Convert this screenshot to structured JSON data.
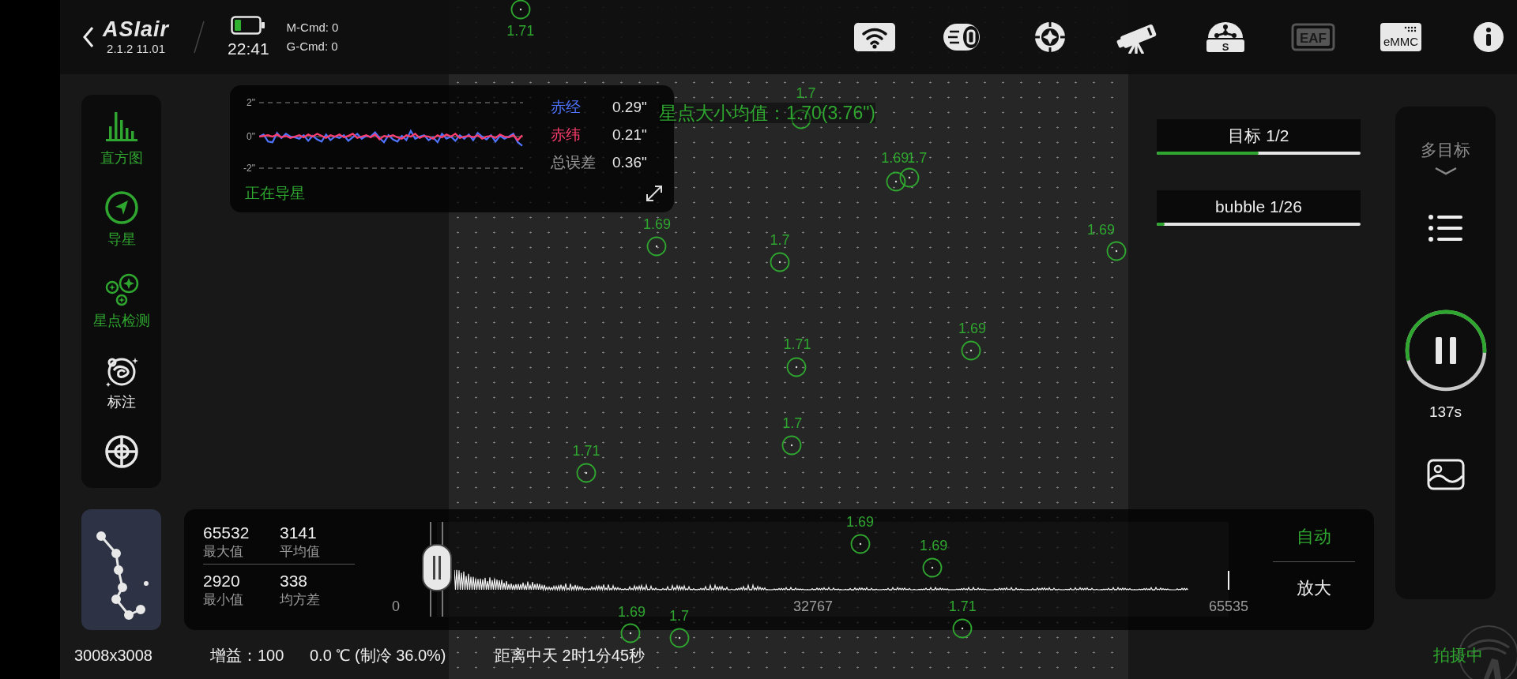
{
  "top_bar": {
    "logo": "ASIair",
    "version": "2.1.2 11.01",
    "time": "22:41",
    "m_cmd": "M-Cmd: 0",
    "g_cmd": "G-Cmd: 0",
    "icons": [
      {
        "kind": "wifi",
        "disabled": false
      },
      {
        "kind": "focuser",
        "disabled": false
      },
      {
        "kind": "guide",
        "disabled": false
      },
      {
        "kind": "telescope",
        "disabled": false
      },
      {
        "kind": "dome",
        "text": "S",
        "disabled": false
      },
      {
        "kind": "eaf",
        "text": "EAF",
        "disabled": true
      },
      {
        "kind": "emmc",
        "text": "eMMC",
        "disabled": false
      },
      {
        "kind": "info",
        "disabled": false
      }
    ]
  },
  "sidebar": {
    "items": [
      {
        "kind": "histogram",
        "label": "直方图",
        "on": true
      },
      {
        "kind": "guide",
        "label": "导星",
        "on": true
      },
      {
        "kind": "stars",
        "label": "星点检测",
        "on": true
      },
      {
        "kind": "annotate",
        "label": "标注",
        "on": false
      },
      {
        "kind": "crosshair",
        "on": false
      }
    ]
  },
  "guide_panel": {
    "yticks": [
      "2\"",
      "0\"",
      "-2\""
    ],
    "stats": [
      {
        "label": "赤经",
        "value": "0.29\"",
        "color": "#4f74ff"
      },
      {
        "label": "赤纬",
        "value": "0.21\"",
        "color": "#ff3d6e"
      },
      {
        "label": "总误差",
        "value": "0.36\"",
        "color": "#9a9a9a"
      }
    ],
    "status": "正在导星"
  },
  "star_size_average": "星点大小均值：1.70(3.76\")",
  "star_markers": [
    {
      "label": "1.71"
    },
    {
      "label": "1.7"
    },
    {
      "label": "1.69"
    },
    {
      "label": "1.7"
    },
    {
      "label": "1.69"
    },
    {
      "label": "1.7"
    },
    {
      "label": "1.69"
    },
    {
      "label": "1.69"
    },
    {
      "label": "1.71"
    },
    {
      "label": "1.7"
    },
    {
      "label": "1.71"
    },
    {
      "label": "1.69"
    },
    {
      "label": "1.69"
    },
    {
      "label": "1.71"
    },
    {
      "label": "1.7"
    },
    {
      "label": "1.69"
    }
  ],
  "sequence": [
    {
      "label": "目标 1/2",
      "level": 0.5
    },
    {
      "label": "bubble 1/26",
      "level": 0.04
    }
  ],
  "right_panel": {
    "mode": "多目标",
    "exposure": {
      "level": 0.55,
      "remaining": "137s"
    }
  },
  "histogram": {
    "stats": [
      {
        "value": "65532",
        "label": "最大值"
      },
      {
        "value": "3141",
        "label": "平均值"
      },
      {
        "value": "2920",
        "label": "最小值"
      },
      {
        "value": "338",
        "label": "均方差"
      }
    ],
    "axis": [
      "0",
      "32767",
      "65535"
    ],
    "black_point": {
      "level": 0
    },
    "white_point": {
      "level": 1
    },
    "buttons": [
      {
        "label": "自动",
        "on": true
      },
      {
        "label": "放大",
        "on": false
      }
    ]
  },
  "status_bar": {
    "items": [
      "3008x3008",
      "增益：100",
      "0.0 ℃ (制冷 36.0%)",
      "距离中天 2时1分45秒"
    ],
    "state": "拍摄中"
  }
}
